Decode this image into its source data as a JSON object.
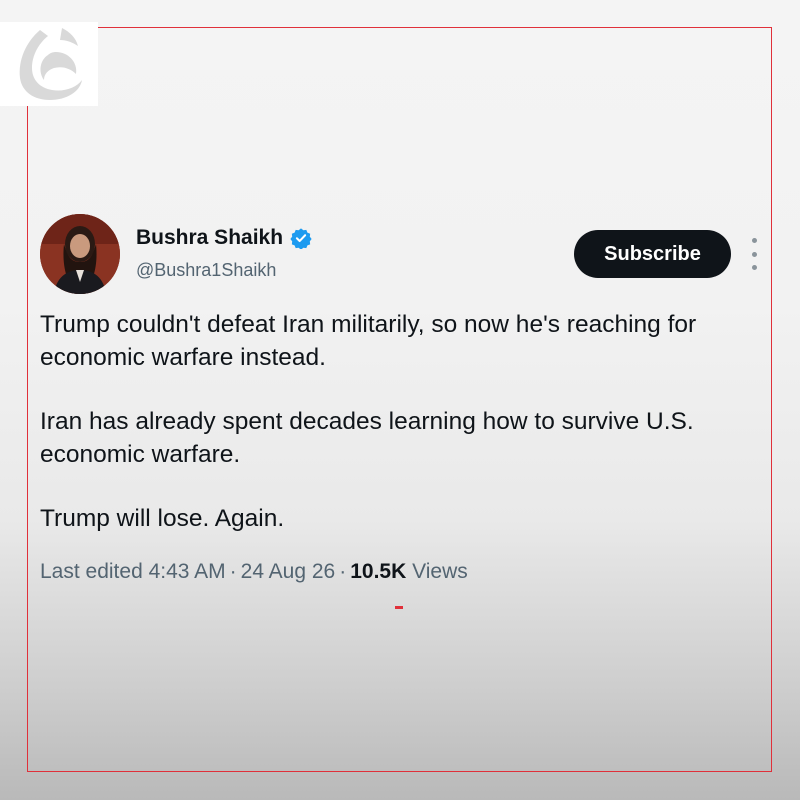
{
  "post": {
    "author_name": "Bushra Shaikh",
    "handle": "@Bushra1Shaikh",
    "subscribe_label": "Subscribe",
    "paragraphs": [
      "Trump couldn't defeat Iran militarily, so now he's reaching for economic warfare instead.",
      "Iran has already spent decades learning how to survive U.S. economic warfare.",
      "Trump will lose. Again."
    ],
    "meta": {
      "edited": "Last edited 4:43 AM",
      "date": "24 Aug 26",
      "views_count": "10.5K",
      "views_label": "Views"
    }
  },
  "colors": {
    "verified": "#1d9bf0",
    "frame": "#e0303a",
    "button_bg": "#0f1419"
  },
  "icons": {
    "logo": "brand-logo-icon",
    "verified": "verified-badge-icon",
    "more": "more-vertical-icon"
  }
}
